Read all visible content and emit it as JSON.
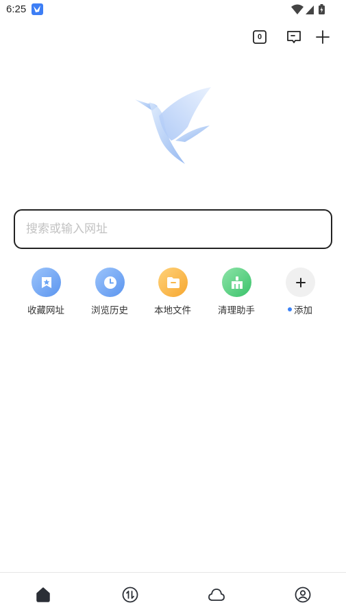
{
  "status_bar": {
    "time": "6:25",
    "app_icon": "bird-app-icon",
    "indicators": [
      "wifi-icon",
      "signal-icon",
      "battery-charging-icon"
    ]
  },
  "toolbar": {
    "tabs_count": "0",
    "tabs_icon": "tabs-counter-icon",
    "message_icon": "message-icon",
    "add_icon": "plus-icon"
  },
  "logo": {
    "icon": "hummingbird-logo",
    "color": "#8fb4f0"
  },
  "search": {
    "placeholder": "搜索或输入网址",
    "value": ""
  },
  "shortcuts": [
    {
      "label": "收藏网址",
      "icon": "bookmark-star-icon",
      "color": "#6aa3f3"
    },
    {
      "label": "浏览历史",
      "icon": "clock-icon",
      "color": "#6aa3f3"
    },
    {
      "label": "本地文件",
      "icon": "folder-icon",
      "color": "#f7b64a"
    },
    {
      "label": "清理助手",
      "icon": "broom-icon",
      "color": "#4fcf7f"
    },
    {
      "label": "添加",
      "icon": "plus-icon",
      "color": "#f0f0f0",
      "has_dot": true,
      "dot_color": "#3b82f6"
    }
  ],
  "bottom_nav": [
    {
      "name": "home",
      "icon": "home-icon",
      "active": true
    },
    {
      "name": "transfer",
      "icon": "transfer-icon"
    },
    {
      "name": "cloud",
      "icon": "cloud-icon"
    },
    {
      "name": "profile",
      "icon": "profile-icon"
    }
  ]
}
